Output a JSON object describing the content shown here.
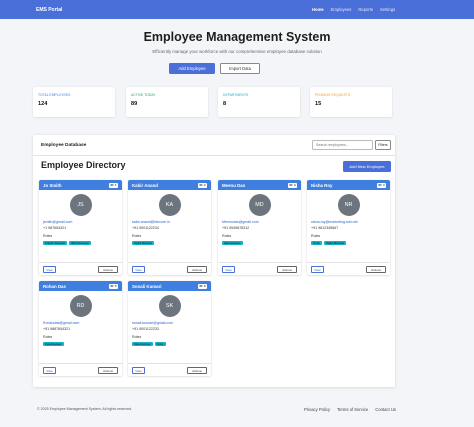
{
  "navbar": {
    "brand": "EMS Portal",
    "links": [
      "Home",
      "Employees",
      "Reports",
      "Settings"
    ]
  },
  "hero": {
    "title": "Employee Management System",
    "subtitle": "Efficiently manage your workforce with our comprehensive employee database solution",
    "add_button": "Add Employee",
    "import_button": "Import Data"
  },
  "stats": [
    {
      "label": "TOTAL EMPLOYEES",
      "value": "124",
      "color": "#3f7fe0"
    },
    {
      "label": "ACTIVE TODAY",
      "value": "89",
      "color": "#2e9e5b"
    },
    {
      "label": "DEPARTMENTS",
      "value": "8",
      "color": "#12b5c7"
    },
    {
      "label": "PENDING REQUESTS",
      "value": "15",
      "color": "#f0a030"
    }
  ],
  "database": {
    "title": "Employee Database",
    "search_placeholder": "Search employees...",
    "filter_label": "Filters",
    "directory_title": "Employee Directory",
    "add_new_label": "Add New Employee"
  },
  "employees": [
    {
      "name": "Jo Smith",
      "id": "ID: 1",
      "initials": "JS",
      "email": "jsmith@gmail.com",
      "phone": "+1 987654321",
      "roles_label": "Roles",
      "tags": [
        "Graphic Designer",
        "Web Developer"
      ],
      "view": "View",
      "actions": "Actions"
    },
    {
      "name": "Kabir Anand",
      "id": "ID: 2",
      "initials": "KA",
      "email": "kabir.anand@idecore.in",
      "phone": "+91 9001122234",
      "roles_label": "Roles",
      "tags": [
        "Digital Marketer"
      ],
      "view": "View",
      "actions": "Actions"
    },
    {
      "name": "Meenu Das",
      "id": "ID: 3",
      "initials": "MD",
      "email": "Meenudas@gmail.com",
      "phone": "+91 9949678312",
      "roles_label": "Roles",
      "tags": [
        "Data Engineer"
      ],
      "view": "View",
      "actions": "Actions"
    },
    {
      "name": "Nisha Roy",
      "id": "ID: 4",
      "initials": "NR",
      "email": "nisha.roy@marketing.tuki.net",
      "phone": "+91 9812345667",
      "roles_label": "Roles",
      "tags": [
        "Tester",
        "Digital Marketer"
      ],
      "view": "View",
      "actions": "Actions"
    },
    {
      "name": "Rohan Das",
      "id": "ID: 5",
      "initials": "RD",
      "email": "Rohandas@gmail.com",
      "phone": "+91 9887654321",
      "roles_label": "Roles",
      "tags": [
        "Data Engineer"
      ],
      "view": "View",
      "actions": "Actions"
    },
    {
      "name": "Sonali Kumari",
      "id": "ID: 6",
      "initials": "SK",
      "email": "sonali.kumari@gmail.com",
      "phone": "+91 9001122233",
      "roles_label": "Roles",
      "tags": [
        "Data Engineer",
        "Tester"
      ],
      "view": "View",
      "actions": "Actions"
    }
  ],
  "footer": {
    "copyright": "© 2025 Employee Management System. All rights reserved.",
    "links": [
      "Privacy Policy",
      "Terms of Service",
      "Contact Us"
    ]
  }
}
